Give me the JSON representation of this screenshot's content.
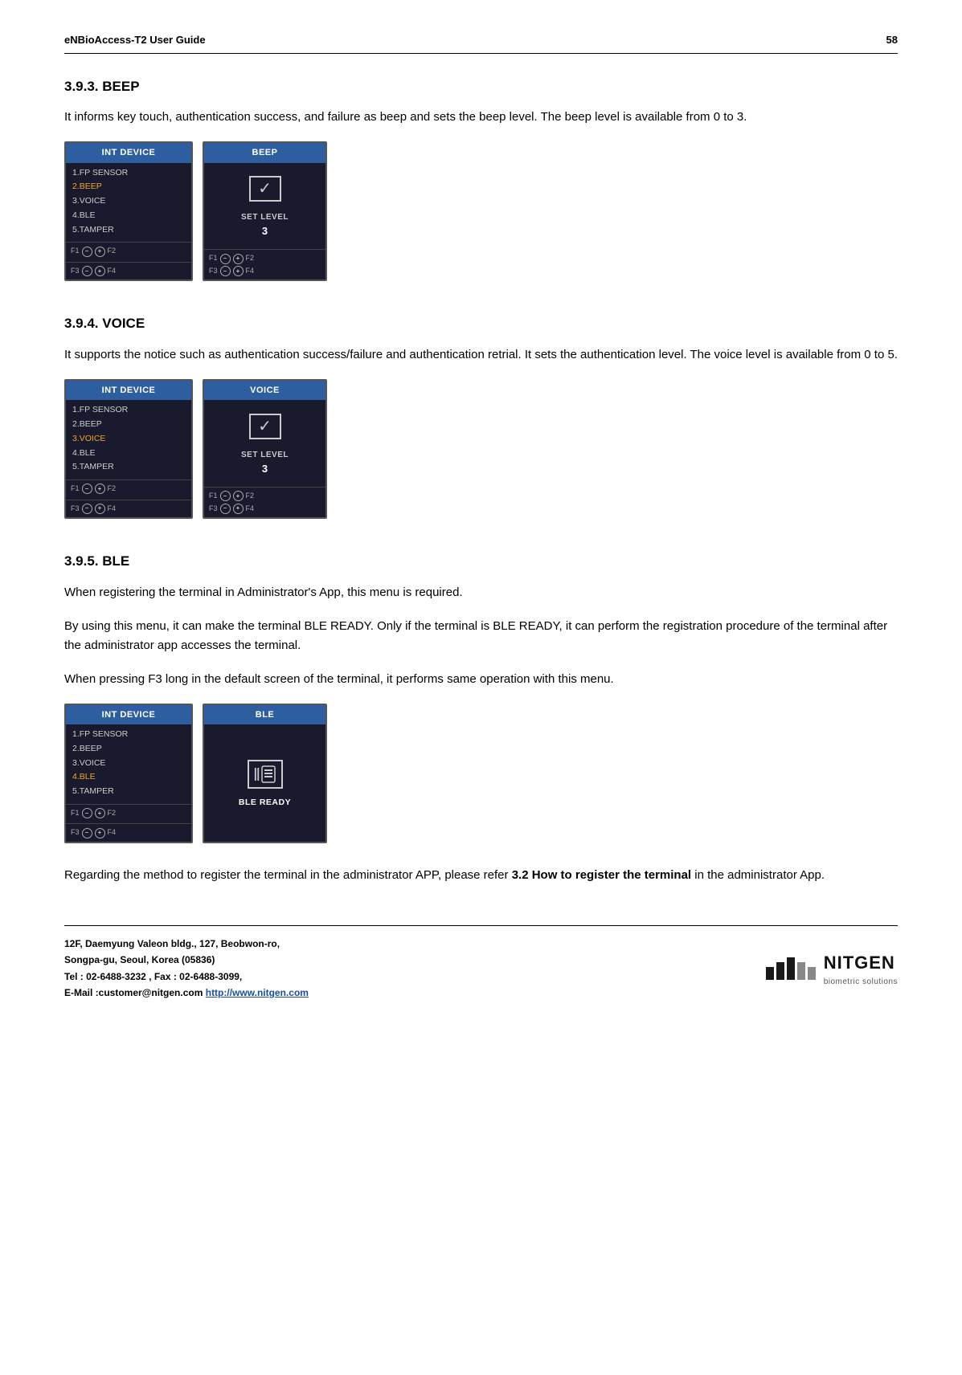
{
  "header": {
    "title": "eNBioAccess-T2 User Guide",
    "page_number": "58"
  },
  "sections": [
    {
      "id": "beep",
      "heading": "3.9.3.  BEEP",
      "body": "It informs key touch, authentication success, and failure as beep and sets the beep level. The beep level is available from 0 to 3.",
      "left_screen": {
        "header": "INT DEVICE",
        "menu_items": [
          {
            "label": "1.FP SENSOR",
            "active": false
          },
          {
            "label": "2.BEEP",
            "active": true
          },
          {
            "label": "3.VOICE",
            "active": false
          },
          {
            "label": "4.BLE",
            "active": false
          },
          {
            "label": "5.TAMPER",
            "active": false
          }
        ]
      },
      "right_screen": {
        "header": "BEEP",
        "set_level_label": "SET LEVEL",
        "set_level_value": "3"
      }
    },
    {
      "id": "voice",
      "heading": "3.9.4.  VOICE",
      "body": "It supports the notice such as authentication success/failure and authentication retrial. It sets the authentication level. The voice level is available from 0 to 5.",
      "left_screen": {
        "header": "INT DEVICE",
        "menu_items": [
          {
            "label": "1.FP SENSOR",
            "active": false
          },
          {
            "label": "2.BEEP",
            "active": false
          },
          {
            "label": "3.VOICE",
            "active": true
          },
          {
            "label": "4.BLE",
            "active": false
          },
          {
            "label": "5.TAMPER",
            "active": false
          }
        ]
      },
      "right_screen": {
        "header": "VOICE",
        "set_level_label": "SET LEVEL",
        "set_level_value": "3"
      }
    },
    {
      "id": "ble",
      "heading": "3.9.5.  BLE",
      "body1": "When registering the terminal in Administrator's App, this menu is required.",
      "body2": "By using this menu, it can make the terminal BLE READY. Only if the terminal is BLE READY, it can perform the registration procedure of the terminal after the administrator app accesses the terminal.",
      "body3": "When pressing F3 long in the default screen of the terminal, it performs same operation with this menu.",
      "left_screen": {
        "header": "INT DEVICE",
        "menu_items": [
          {
            "label": "1.FP SENSOR",
            "active": false
          },
          {
            "label": "2.BEEP",
            "active": false
          },
          {
            "label": "3.VOICE",
            "active": false
          },
          {
            "label": "4.BLE",
            "active": true
          },
          {
            "label": "5.TAMPER",
            "active": false
          }
        ]
      },
      "right_screen": {
        "header": "BLE",
        "ble_ready_label": "BLE READY"
      },
      "note": "Regarding the method to register the terminal in the administrator APP, please refer ",
      "note_bold": "3.2 How to register the terminal",
      "note_end": " in the administrator App."
    }
  ],
  "footer": {
    "address_line1": "12F, Daemyung Valeon bldg., 127, Beobwon-ro,",
    "address_line2": "Songpa-gu, Seoul, Korea (05836)",
    "address_line3": "Tel : 02-6488-3232 , Fax : 02-6488-3099,",
    "address_line4": "E-Mail :customer@nitgen.com ",
    "address_url": "http://www.nitgen.com",
    "logo_name": "NITGEN",
    "logo_sub": "biometric solutions"
  },
  "buttons": {
    "f1": "F1",
    "f2": "F2",
    "f3": "F3",
    "f4": "F4",
    "minus": "−",
    "plus": "+"
  }
}
